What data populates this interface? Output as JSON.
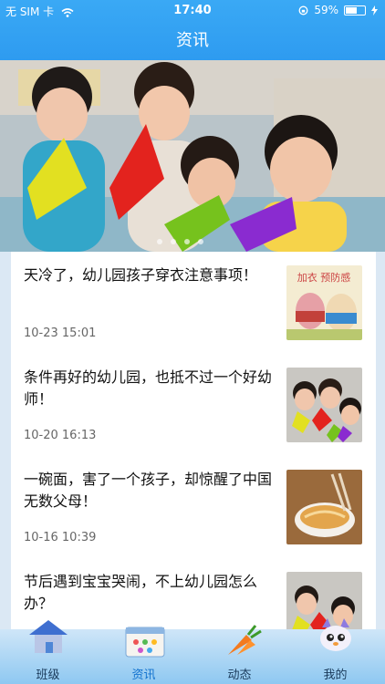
{
  "status": {
    "carrier": "无 SIM 卡",
    "time": "17:40",
    "battery": "59%",
    "battery_level": 0.59
  },
  "header": {
    "title": "资讯"
  },
  "banner": {
    "slide_count": 4
  },
  "news": [
    {
      "title": "天冷了，幼儿园孩子穿衣注意事项！",
      "date": "10-23 15:01",
      "thumb_text": "加衣 预防感"
    },
    {
      "title": "条件再好的幼儿园，也抵不过一个好幼师！",
      "date": "10-20 16:13"
    },
    {
      "title": "一碗面，害了一个孩子，却惊醒了中国无数父母！",
      "date": "10-16 10:39"
    },
    {
      "title": "节后遇到宝宝哭闹，不上幼儿园怎么办？",
      "date": ""
    }
  ],
  "tabs": [
    {
      "label": "班级",
      "icon": "house-icon"
    },
    {
      "label": "资讯",
      "icon": "calendar-icon",
      "active": true
    },
    {
      "label": "动态",
      "icon": "carrot-icon"
    },
    {
      "label": "我的",
      "icon": "cat-icon"
    }
  ]
}
